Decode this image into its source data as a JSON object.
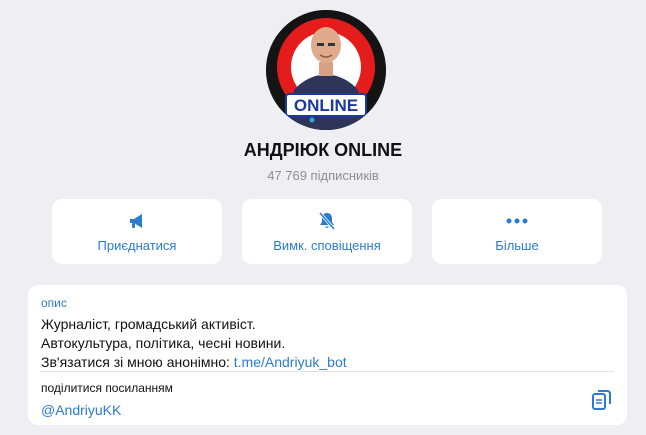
{
  "channel": {
    "name": "АНДРІЮК ONLINE",
    "subscribers": "47 769 підписників",
    "avatar_badge": "ONLINE"
  },
  "actions": [
    {
      "label": "Приєднатися",
      "icon": "megaphone-icon"
    },
    {
      "label": "Вимк. сповіщення",
      "icon": "bell-off-icon"
    },
    {
      "label": "Більше",
      "icon": "more-dots-icon"
    }
  ],
  "info": {
    "description_label": "опис",
    "description_lines": [
      "Журналіст, громадський активіст.",
      "Автокультура, політика, чесні новини."
    ],
    "contact_text": "Зв'язатися зі мною анонімно: ",
    "contact_link": "t.me/Andriyuk_bot",
    "share_label": "поділитися посиланням",
    "share_link": "@AndriyuKK"
  },
  "colors": {
    "accent": "#2b7bd1",
    "background": "#efeff3",
    "card": "#ffffff"
  }
}
